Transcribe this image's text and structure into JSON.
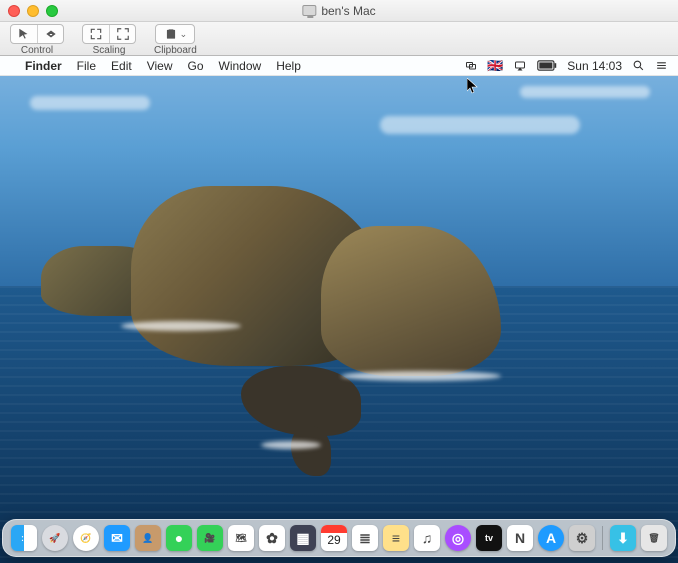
{
  "window": {
    "title": "ben's Mac"
  },
  "toolbar": {
    "groups": [
      {
        "label": "Control"
      },
      {
        "label": "Scaling"
      },
      {
        "label": "Clipboard"
      }
    ]
  },
  "menubar": {
    "app": "Finder",
    "items": [
      "File",
      "Edit",
      "View",
      "Go",
      "Window",
      "Help"
    ],
    "clock": "Sun 14:03",
    "status_icons": [
      "cursor-icon",
      "displays-icon",
      "input-source-icon",
      "airplay-icon",
      "battery-icon"
    ],
    "right_icons": [
      "spotlight-icon",
      "control-center-icon"
    ]
  },
  "dock": {
    "items": [
      {
        "name": "finder",
        "color1": "#2aa7f5",
        "color2": "#ffffff",
        "glyph": "ːː"
      },
      {
        "name": "launchpad",
        "color1": "#d9dbe0",
        "glyph": "🚀",
        "round": true
      },
      {
        "name": "safari",
        "color1": "#ffffff",
        "glyph": "🧭",
        "round": true
      },
      {
        "name": "mail",
        "color1": "#1f9bff",
        "glyph": "✉"
      },
      {
        "name": "contacts",
        "color1": "#c79a6b",
        "glyph": "👤"
      },
      {
        "name": "messages",
        "color1": "#34d158",
        "glyph": "●"
      },
      {
        "name": "facetime",
        "color1": "#34d158",
        "glyph": "🎥"
      },
      {
        "name": "maps",
        "color1": "#ffffff",
        "glyph": "🗺"
      },
      {
        "name": "photos",
        "color1": "#ffffff",
        "glyph": "✿"
      },
      {
        "name": "mission-control",
        "color1": "#3f4254",
        "glyph": "▦"
      },
      {
        "name": "calendar",
        "color1": "#ffffff",
        "glyph": "",
        "date": "29"
      },
      {
        "name": "reminders",
        "color1": "#ffffff",
        "glyph": "≣"
      },
      {
        "name": "notes",
        "color1": "#ffe08a",
        "glyph": "≡"
      },
      {
        "name": "music",
        "color1": "#ffffff",
        "glyph": "♫"
      },
      {
        "name": "podcasts",
        "color1": "#a94dff",
        "glyph": "◎",
        "round": true
      },
      {
        "name": "tv",
        "color1": "#111111",
        "glyph": "tv"
      },
      {
        "name": "news",
        "color1": "#ffffff",
        "glyph": "N"
      },
      {
        "name": "app-store",
        "color1": "#1e9bff",
        "glyph": "A",
        "round": true
      },
      {
        "name": "system-preferences",
        "color1": "#cfcfcf",
        "glyph": "⚙"
      }
    ],
    "right": [
      {
        "name": "downloads",
        "color1": "#37c1e6",
        "glyph": "⬇"
      },
      {
        "name": "trash",
        "color1": "#e6e6e6",
        "glyph": "🗑"
      }
    ]
  }
}
